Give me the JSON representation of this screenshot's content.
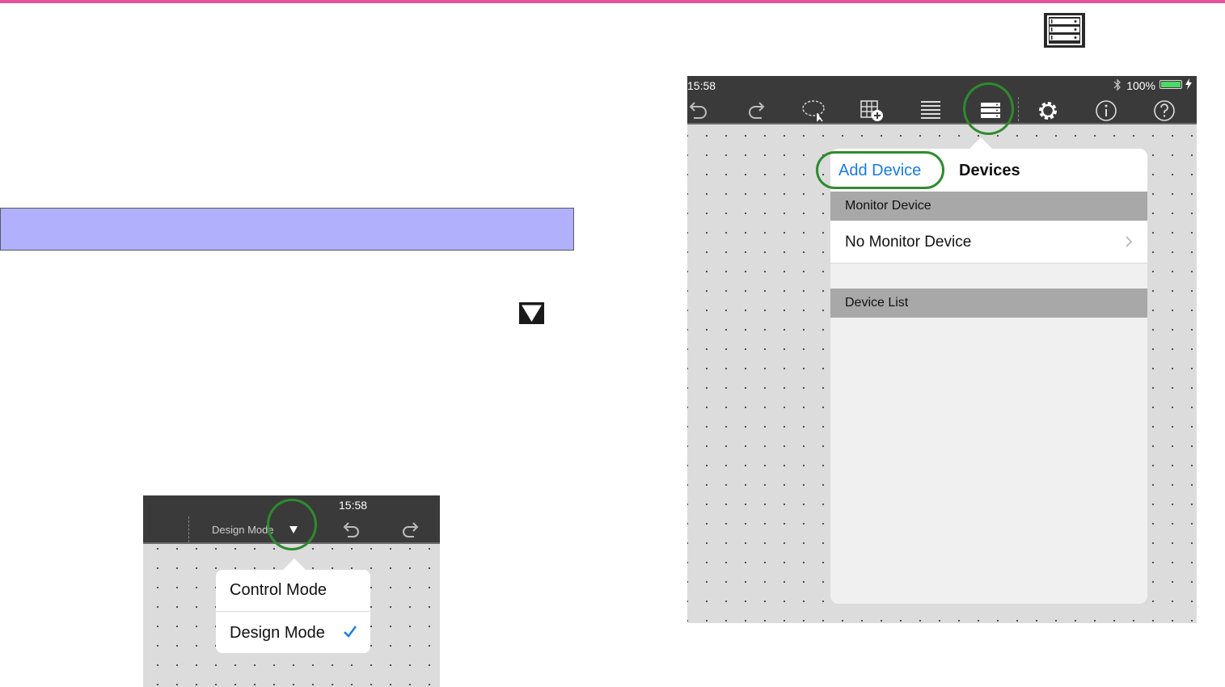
{
  "small_screenshot": {
    "time": "15:58",
    "mode_label": "Design Mode",
    "menu": {
      "items": [
        "Control Mode",
        "Design Mode"
      ],
      "selected": "Design Mode"
    }
  },
  "large_screenshot": {
    "time": "15:58",
    "battery_text": "100%",
    "toolbar_icons": [
      "undo-icon",
      "redo-icon",
      "lasso-select-icon",
      "add-grid-icon",
      "list-icon",
      "device-rack-icon",
      "settings-gear-icon",
      "info-icon",
      "help-icon"
    ],
    "popover": {
      "add_device_label": "Add Device",
      "title": "Devices",
      "section_monitor": "Monitor Device",
      "monitor_value": "No Monitor Device",
      "section_list": "Device List"
    }
  },
  "colors": {
    "accent_line": "#e0559a",
    "banner": "#b0b0fc",
    "highlight_ring": "#2e8b2e",
    "link_blue": "#1a7ae0",
    "battery": "#4cd964"
  }
}
